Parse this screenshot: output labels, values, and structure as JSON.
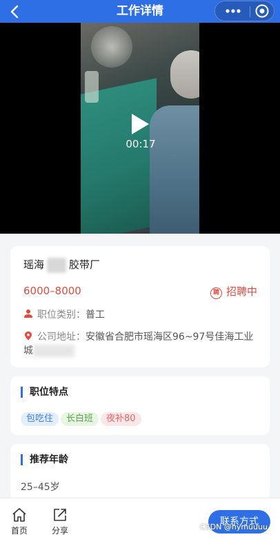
{
  "nav": {
    "title": "工作详情"
  },
  "video": {
    "time": "00:17"
  },
  "job": {
    "company_prefix": "瑶海",
    "company_suffix": "胶带厂",
    "salary": "6000–8000",
    "status": "招聘中",
    "status_badge": "聘",
    "category_label": "职位类别：",
    "category_value": "普工",
    "address_label": "公司地址：",
    "address_value": "安徽省合肥市瑶海区96~97号佳海工业城"
  },
  "features": {
    "title": "职位特点",
    "tags": [
      "包吃住",
      "长白班",
      "夜补80"
    ]
  },
  "age": {
    "title": "推荐年龄",
    "value": "25–45岁"
  },
  "tabbar": {
    "home": "首页",
    "share": "分享",
    "contact": "联系方式",
    "watermark": "CSDN @hymuuuu"
  },
  "colors": {
    "accent": "#2f6fe6",
    "salary": "#e24a3f"
  }
}
